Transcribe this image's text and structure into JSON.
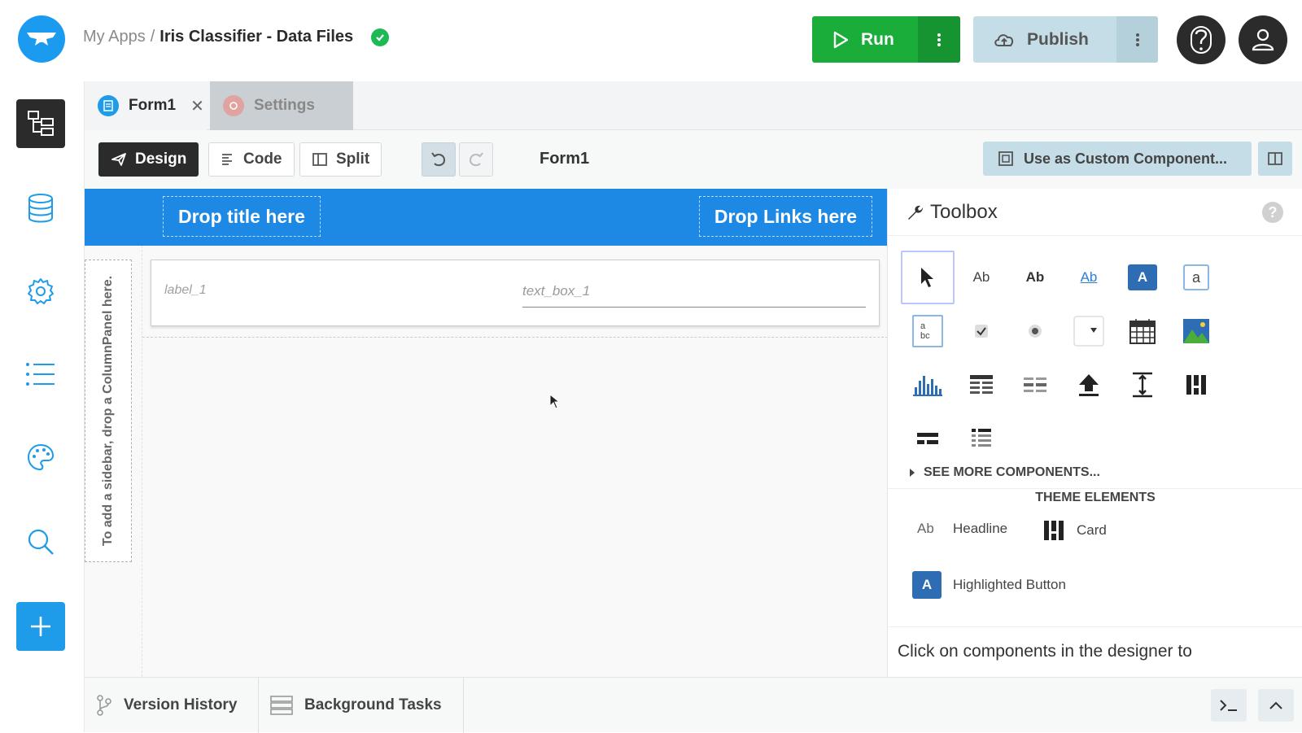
{
  "topbar": {
    "breadcrumb_root": "My Apps",
    "separator": "/",
    "app_title": "Iris Classifier - Data Files",
    "run_label": "Run",
    "publish_label": "Publish"
  },
  "left_nav": {
    "items": [
      "app-browser-icon",
      "database-icon",
      "gear-icon",
      "list-icon",
      "palette-icon",
      "search-icon",
      "plus-icon"
    ]
  },
  "tabs": [
    {
      "label": "Form1"
    },
    {
      "label": "Settings"
    }
  ],
  "editor_toolbar": {
    "design_label": "Design",
    "code_label": "Code",
    "split_label": "Split",
    "form_name": "Form1",
    "custom_component_label": "Use as Custom Component..."
  },
  "designer": {
    "drop_title": "Drop title here",
    "drop_links": "Drop Links here",
    "sidebar_hint": "To add a sidebar, drop a ColumnPanel here.",
    "label_placeholder": "label_1",
    "textbox_placeholder": "text_box_1"
  },
  "toolbox": {
    "title": "Toolbox",
    "help_glyph": "?",
    "tool_texts": {
      "label": "Ab",
      "bold_label": "Ab",
      "link": "Ab",
      "button": "A",
      "textbox": "a",
      "textarea_top": "a",
      "textarea_bottom": "bc"
    },
    "see_more": "SEE MORE COMPONENTS...",
    "theme_elements_title": "THEME ELEMENTS",
    "theme_items": [
      {
        "icon_text": "Ab",
        "label": "Headline"
      },
      {
        "label": "Card"
      },
      {
        "icon_text": "A",
        "label": "Highlighted Button"
      }
    ],
    "hint": "Click on components in the designer to"
  },
  "bottombar": {
    "version_history": "Version History",
    "background_tasks": "Background Tasks"
  },
  "colors": {
    "run_green": "#1aad3a",
    "brand_blue": "#1e88e5",
    "publish_bg": "#c5dde6"
  }
}
